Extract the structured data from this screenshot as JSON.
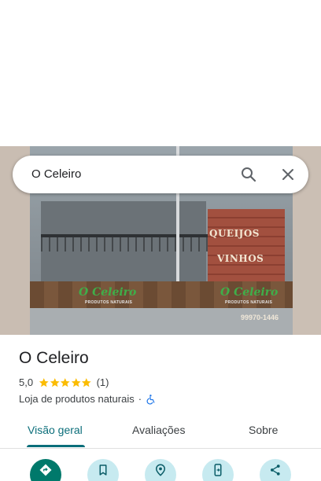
{
  "search": {
    "query": "O Celeiro"
  },
  "photo": {
    "sign_brand": "O Celeiro",
    "sign_subtitle": "PRODUTOS NATURAIS",
    "wall_text_1": "QUEIJOS",
    "wall_text_2": "VINHOS",
    "phone_fragment": "99970-1446"
  },
  "place": {
    "name": "O Celeiro",
    "rating": "5,0",
    "stars": 5,
    "review_count": "(1)",
    "category": "Loja de produtos naturais",
    "separator": "·",
    "accessibility_icon": "wheelchair-icon"
  },
  "tabs": [
    {
      "label": "Visão geral",
      "active": true
    },
    {
      "label": "Avaliações",
      "active": false
    },
    {
      "label": "Sobre",
      "active": false
    }
  ],
  "actions": [
    {
      "icon": "directions-icon"
    },
    {
      "icon": "bookmark-icon"
    },
    {
      "icon": "nearby-icon"
    },
    {
      "icon": "send-to-phone-icon"
    },
    {
      "icon": "share-icon"
    }
  ],
  "colors": {
    "accent": "#0b6e7a",
    "primary_action": "#00796b",
    "action_bg": "#c7eaf0",
    "star": "#fbbc04",
    "accessibility": "#1a73e8"
  }
}
